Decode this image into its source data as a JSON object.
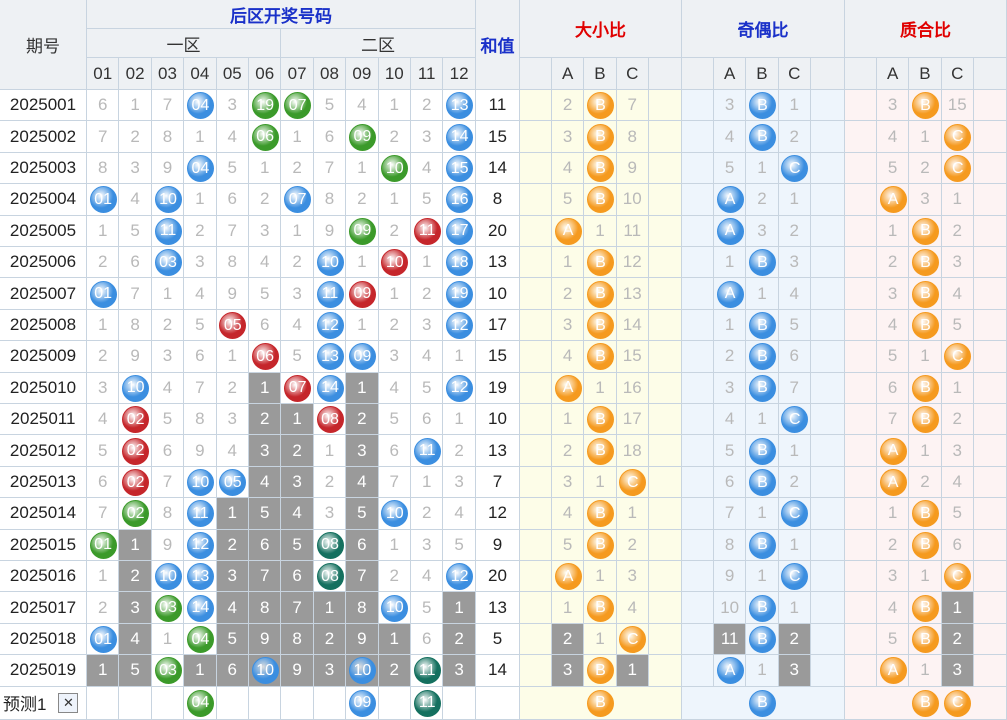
{
  "header": {
    "period_label": "期号",
    "rear_area_title": "后区开奖号码",
    "zone1_label": "一区",
    "zone2_label": "二区",
    "sum_label": "和值",
    "ratio_titles": [
      "大小比",
      "奇偶比",
      "质合比"
    ],
    "number_labels": [
      "01",
      "02",
      "03",
      "04",
      "05",
      "06",
      "07",
      "08",
      "09",
      "10",
      "11",
      "12"
    ],
    "abc_labels": [
      "A",
      "B",
      "C"
    ]
  },
  "rows": [
    {
      "period": "2025001",
      "nums": [
        "6",
        "1",
        "7",
        "04",
        "3",
        "19",
        "07",
        "5",
        "4",
        "1",
        "2",
        "13"
      ],
      "sum": "11",
      "ratio": [
        [
          "2",
          "B",
          "7"
        ],
        [
          "3",
          "B",
          "1"
        ],
        [
          "3",
          "B",
          "15"
        ]
      ]
    },
    {
      "period": "2025002",
      "nums": [
        "7",
        "2",
        "8",
        "1",
        "4",
        "06",
        "1",
        "6",
        "09",
        "2",
        "3",
        "14"
      ],
      "sum": "15",
      "ratio": [
        [
          "3",
          "B",
          "8"
        ],
        [
          "4",
          "B",
          "2"
        ],
        [
          "4",
          "1",
          "C"
        ]
      ]
    },
    {
      "period": "2025003",
      "nums": [
        "8",
        "3",
        "9",
        "04",
        "5",
        "1",
        "2",
        "7",
        "1",
        "10",
        "4",
        "15"
      ],
      "sum": "14",
      "ratio": [
        [
          "4",
          "B",
          "9"
        ],
        [
          "5",
          "1",
          "C"
        ],
        [
          "5",
          "2",
          "C"
        ]
      ]
    },
    {
      "period": "2025004",
      "nums": [
        "01",
        "4",
        "10",
        "1",
        "6",
        "2",
        "07",
        "8",
        "2",
        "1",
        "5",
        "16"
      ],
      "sum": "8",
      "ratio": [
        [
          "5",
          "B",
          "10"
        ],
        [
          "A",
          "2",
          "1"
        ],
        [
          "A",
          "3",
          "1"
        ]
      ]
    },
    {
      "period": "2025005",
      "nums": [
        "1",
        "5",
        "11",
        "2",
        "7",
        "3",
        "1",
        "9",
        "09",
        "2",
        "11",
        "17"
      ],
      "sum": "20",
      "ratio": [
        [
          "A",
          "1",
          "11"
        ],
        [
          "A",
          "3",
          "2"
        ],
        [
          "1",
          "B",
          "2"
        ]
      ]
    },
    {
      "period": "2025006",
      "nums": [
        "2",
        "6",
        "03",
        "3",
        "8",
        "4",
        "2",
        "10",
        "1",
        "10",
        "1",
        "18"
      ],
      "sum": "13",
      "ratio": [
        [
          "1",
          "B",
          "12"
        ],
        [
          "1",
          "B",
          "3"
        ],
        [
          "2",
          "B",
          "3"
        ]
      ]
    },
    {
      "period": "2025007",
      "nums": [
        "01",
        "7",
        "1",
        "4",
        "9",
        "5",
        "3",
        "11",
        "09",
        "1",
        "2",
        "19"
      ],
      "sum": "10",
      "ratio": [
        [
          "2",
          "B",
          "13"
        ],
        [
          "A",
          "1",
          "4"
        ],
        [
          "3",
          "B",
          "4"
        ]
      ]
    },
    {
      "period": "2025008",
      "nums": [
        "1",
        "8",
        "2",
        "5",
        "05",
        "6",
        "4",
        "12",
        "1",
        "2",
        "3",
        "12"
      ],
      "sum": "17",
      "ratio": [
        [
          "3",
          "B",
          "14"
        ],
        [
          "1",
          "B",
          "5"
        ],
        [
          "4",
          "B",
          "5"
        ]
      ]
    },
    {
      "period": "2025009",
      "nums": [
        "2",
        "9",
        "3",
        "6",
        "1",
        "06",
        "5",
        "13",
        "09",
        "3",
        "4",
        "1"
      ],
      "sum": "15",
      "ratio": [
        [
          "4",
          "B",
          "15"
        ],
        [
          "2",
          "B",
          "6"
        ],
        [
          "5",
          "1",
          "C"
        ]
      ]
    },
    {
      "period": "2025010",
      "nums": [
        "3",
        "10",
        "4",
        "7",
        "2",
        "1",
        "07",
        "14",
        "1",
        "4",
        "5",
        "12"
      ],
      "sum": "19",
      "ratio": [
        [
          "A",
          "1",
          "16"
        ],
        [
          "3",
          "B",
          "7"
        ],
        [
          "6",
          "B",
          "1"
        ]
      ]
    },
    {
      "period": "2025011",
      "nums": [
        "4",
        "02",
        "5",
        "8",
        "3",
        "2",
        "1",
        "08",
        "2",
        "5",
        "6",
        "1"
      ],
      "sum": "10",
      "ratio": [
        [
          "1",
          "B",
          "17"
        ],
        [
          "4",
          "1",
          "C"
        ],
        [
          "7",
          "B",
          "2"
        ]
      ]
    },
    {
      "period": "2025012",
      "nums": [
        "5",
        "02",
        "6",
        "9",
        "4",
        "3",
        "2",
        "1",
        "3",
        "6",
        "11",
        "2"
      ],
      "sum": "13",
      "ratio": [
        [
          "2",
          "B",
          "18"
        ],
        [
          "5",
          "B",
          "1"
        ],
        [
          "A",
          "1",
          "3"
        ]
      ]
    },
    {
      "period": "2025013",
      "nums": [
        "6",
        "02",
        "7",
        "10",
        "05",
        "4",
        "3",
        "2",
        "4",
        "7",
        "1",
        "3"
      ],
      "sum": "7",
      "ratio": [
        [
          "3",
          "1",
          "C"
        ],
        [
          "6",
          "B",
          "2"
        ],
        [
          "A",
          "2",
          "4"
        ]
      ]
    },
    {
      "period": "2025014",
      "nums": [
        "7",
        "02",
        "8",
        "11",
        "1",
        "5",
        "4",
        "3",
        "5",
        "10",
        "2",
        "4"
      ],
      "sum": "12",
      "ratio": [
        [
          "4",
          "B",
          "1"
        ],
        [
          "7",
          "1",
          "C"
        ],
        [
          "1",
          "B",
          "5"
        ]
      ]
    },
    {
      "period": "2025015",
      "nums": [
        "01",
        "1",
        "9",
        "12",
        "2",
        "6",
        "5",
        "08",
        "6",
        "1",
        "3",
        "5"
      ],
      "sum": "9",
      "ratio": [
        [
          "5",
          "B",
          "2"
        ],
        [
          "8",
          "B",
          "1"
        ],
        [
          "2",
          "B",
          "6"
        ]
      ]
    },
    {
      "period": "2025016",
      "nums": [
        "1",
        "2",
        "10",
        "13",
        "3",
        "7",
        "6",
        "08",
        "7",
        "2",
        "4",
        "12"
      ],
      "sum": "20",
      "ratio": [
        [
          "A",
          "1",
          "3"
        ],
        [
          "9",
          "1",
          "C"
        ],
        [
          "3",
          "1",
          "C"
        ]
      ]
    },
    {
      "period": "2025017",
      "nums": [
        "2",
        "3",
        "03",
        "14",
        "4",
        "8",
        "7",
        "1",
        "8",
        "10",
        "5",
        "1"
      ],
      "sum": "13",
      "ratio": [
        [
          "1",
          "B",
          "4"
        ],
        [
          "10",
          "B",
          "1"
        ],
        [
          "4",
          "B",
          "1"
        ]
      ]
    },
    {
      "period": "2025018",
      "nums": [
        "01",
        "4",
        "1",
        "04",
        "5",
        "9",
        "8",
        "2",
        "9",
        "1",
        "6",
        "2"
      ],
      "sum": "5",
      "ratio": [
        [
          "2",
          "1",
          "C"
        ],
        [
          "11",
          "B",
          "2"
        ],
        [
          "5",
          "B",
          "2"
        ]
      ]
    },
    {
      "period": "2025019",
      "nums": [
        "1",
        "5",
        "03",
        "1",
        "6",
        "10",
        "9",
        "3",
        "10",
        "2",
        "11",
        "3"
      ],
      "sum": "14",
      "ratio": [
        [
          "3",
          "B",
          "1"
        ],
        [
          "A",
          "1",
          "3"
        ],
        [
          "A",
          "1",
          "3"
        ]
      ]
    }
  ],
  "predict": {
    "label": "预测1",
    "close_symbol": "✕",
    "nums": [
      "",
      "",
      "",
      "04",
      "",
      "",
      "",
      "",
      "09",
      "",
      "11",
      ""
    ],
    "ratio": [
      [
        "",
        "B",
        ""
      ],
      [
        "",
        "B",
        ""
      ],
      [
        "",
        "B",
        "C"
      ]
    ]
  },
  "colors": {
    "blue_ball": "#3b8ee0",
    "green_ball": "#3b9a2a",
    "red_ball": "#c5262b",
    "teal_ball": "#14705f",
    "orange_ball": "#f59a1f",
    "ratio_line": "#f59a1f",
    "oddeven_line": "#2f74c8",
    "grey_miss": "#9a9a9a",
    "yellow_bg": "#fdfde8",
    "blue_bg": "#eef5fc",
    "pink_bg": "#fdf3f3"
  }
}
